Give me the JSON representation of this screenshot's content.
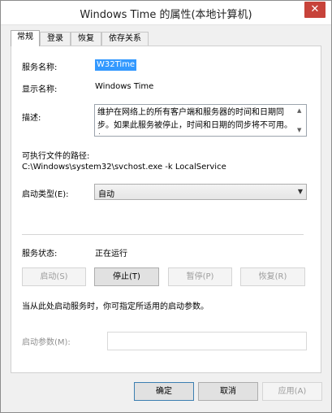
{
  "window": {
    "title": "Windows Time 的属性(本地计算机)",
    "close_glyph": "✕"
  },
  "tabs": [
    "常规",
    "登录",
    "恢复",
    "依存关系"
  ],
  "general": {
    "service_name_label": "服务名称:",
    "service_name_value": "W32Time",
    "display_name_label": "显示名称:",
    "display_name_value": "Windows Time",
    "description_label": "描述:",
    "description_value": "维护在网络上的所有客户端和服务器的时间和日期同步。如果此服务被停止，时间和日期的同步将不可用。如",
    "exe_path_label": "可执行文件的路径:",
    "exe_path_value": "C:\\Windows\\system32\\svchost.exe -k LocalService",
    "startup_type_label": "启动类型(E):",
    "startup_type_value": "自动",
    "status_label": "服务状态:",
    "status_value": "正在运行",
    "buttons": {
      "start": "启动(S)",
      "stop": "停止(T)",
      "pause": "暂停(P)",
      "resume": "恢复(R)"
    },
    "hint": "当从此处启动服务时，你可指定所适用的启动参数。",
    "start_params_label": "启动参数(M):",
    "start_params_value": ""
  },
  "footer": {
    "ok": "确定",
    "cancel": "取消",
    "apply": "应用(A)"
  }
}
